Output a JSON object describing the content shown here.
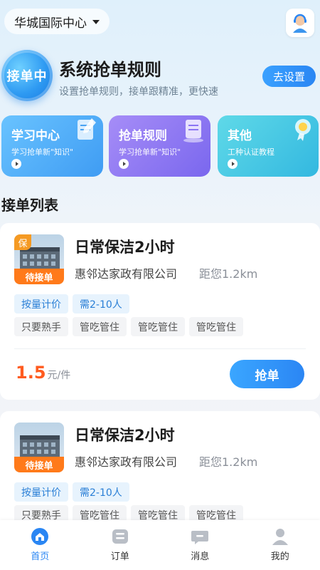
{
  "header": {
    "location": "华城国际中心"
  },
  "banner": {
    "badge": "接单中",
    "title": "系统抢单规则",
    "subtitle": "设置抢单规则，接单跟精准，更快速",
    "setup_button": "去设置"
  },
  "features": [
    {
      "title": "学习中心",
      "subtitle": "学习抢单新\"知识\""
    },
    {
      "title": "抢单规则",
      "subtitle": "学习抢单新\"知识\""
    },
    {
      "title": "其他",
      "subtitle": "工种认证教程"
    }
  ],
  "list": {
    "title": "接单列表",
    "orders": [
      {
        "badge": "保",
        "status": "待接单",
        "title": "日常保洁2小时",
        "company": "惠邻达家政有限公司",
        "distance": "距您1.2km",
        "tags_primary": [
          "按量计价",
          "需2-10人"
        ],
        "tags_secondary": [
          "只要熟手",
          "管吃管住",
          "管吃管住",
          "管吃管住"
        ],
        "price": "1.5",
        "unit": "元/件",
        "action": "抢单"
      },
      {
        "status": "待接单",
        "title": "日常保洁2小时",
        "company": "惠邻达家政有限公司",
        "distance": "距您1.2km",
        "tags_primary": [
          "按量计价",
          "需2-10人"
        ],
        "tags_secondary": [
          "只要熟手",
          "管吃管住",
          "管吃管住",
          "管吃管住"
        ]
      }
    ]
  },
  "tabbar": [
    {
      "label": "首页",
      "icon": "home-icon",
      "active": true
    },
    {
      "label": "订单",
      "icon": "orders-icon",
      "active": false
    },
    {
      "label": "消息",
      "icon": "message-icon",
      "active": false
    },
    {
      "label": "我的",
      "icon": "profile-icon",
      "active": false
    }
  ],
  "colors": {
    "accent": "#2a86f3",
    "price": "#ff5b1f",
    "status": "#ff7a1a"
  }
}
